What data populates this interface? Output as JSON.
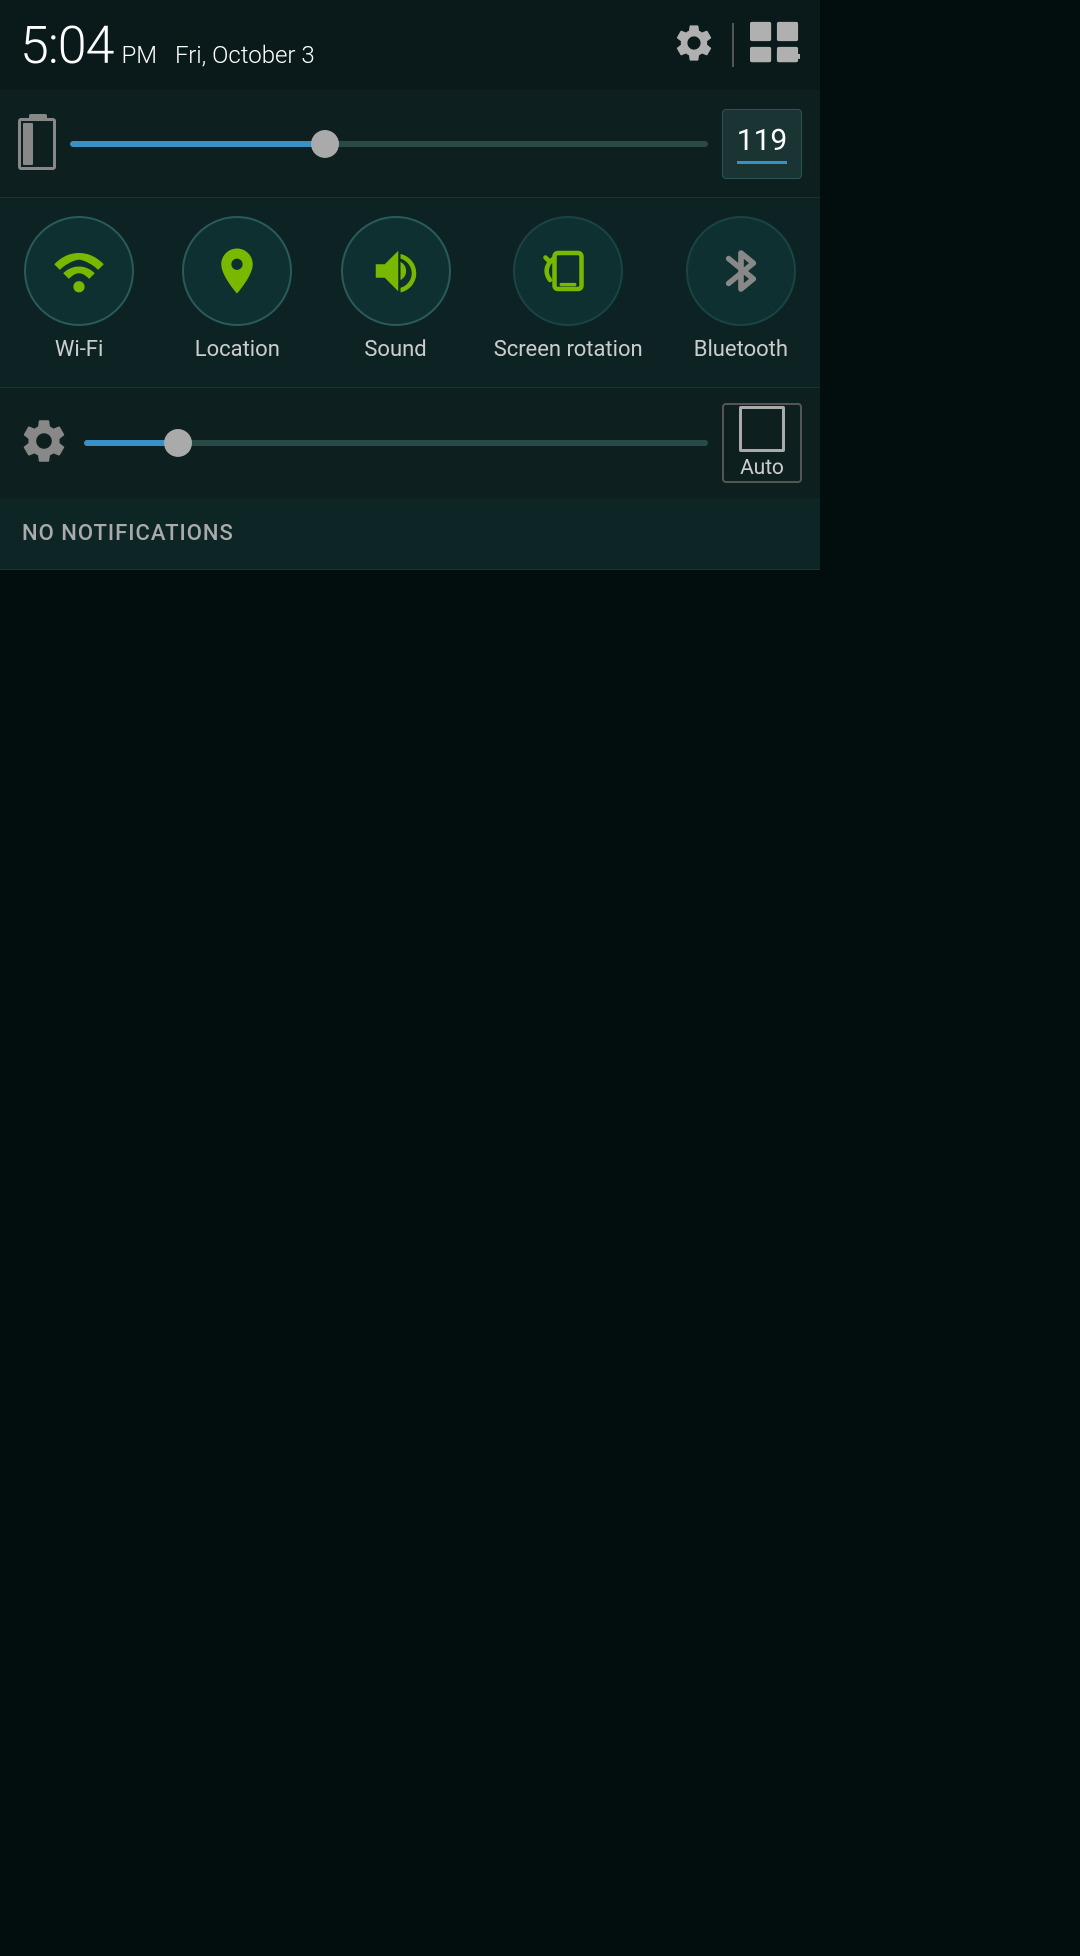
{
  "statusBar": {
    "time": "5:04",
    "ampm": "PM",
    "date": "Fri, October 3"
  },
  "brightness": {
    "value": "119",
    "sliderPercent": 40
  },
  "autoBrightness": {
    "sliderPercent": 15,
    "label": "Auto"
  },
  "toggles": [
    {
      "id": "wifi",
      "label": "Wi-Fi",
      "active": true
    },
    {
      "id": "location",
      "label": "Location",
      "active": true
    },
    {
      "id": "sound",
      "label": "Sound",
      "active": true
    },
    {
      "id": "screen-rotation",
      "label": "Screen rotation",
      "active": false
    },
    {
      "id": "bluetooth",
      "label": "Bluetooth",
      "active": false
    }
  ],
  "notifications": {
    "emptyLabel": "NO NOTIFICATIONS"
  }
}
